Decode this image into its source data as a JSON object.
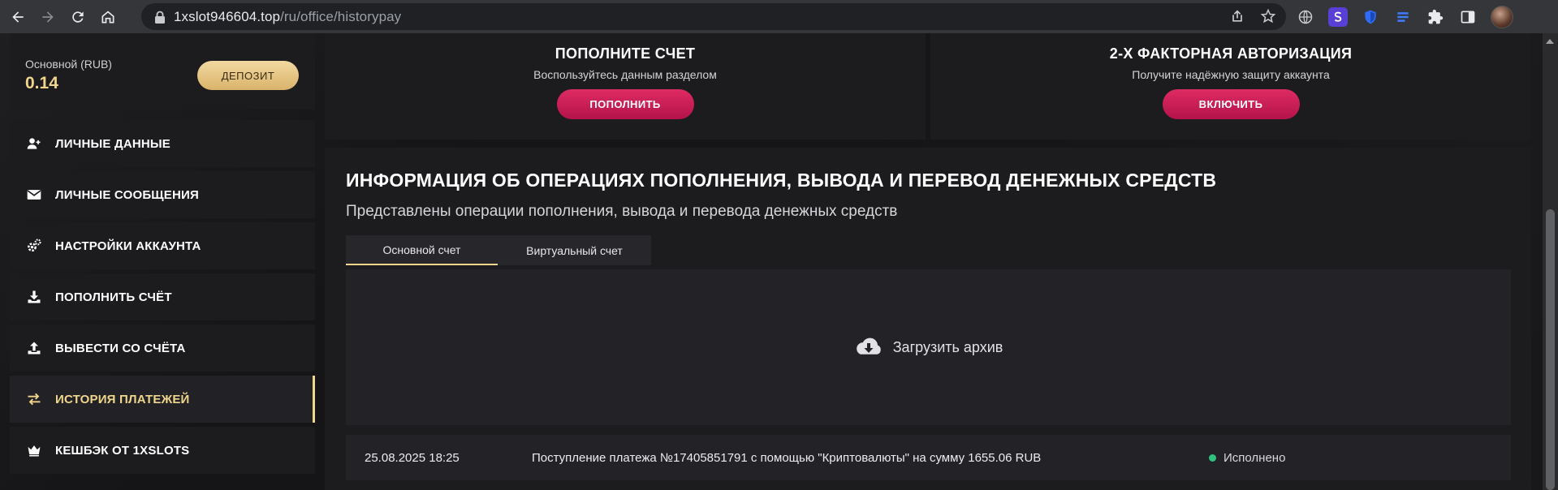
{
  "browser": {
    "url_domain": "1xslot946604.top",
    "url_path": "/ru/office/historypay"
  },
  "balance": {
    "label": "Основной (RUB)",
    "value": "0.14",
    "deposit_label": "ДЕПОЗИТ"
  },
  "sidebar": {
    "items": [
      {
        "label": "ЛИЧНЫЕ ДАННЫЕ",
        "icon": "user-plus-icon"
      },
      {
        "label": "ЛИЧНЫЕ СООБЩЕНИЯ",
        "icon": "envelope-icon"
      },
      {
        "label": "НАСТРОЙКИ АККАУНТА",
        "icon": "gears-icon"
      },
      {
        "label": "ПОПОЛНИТЬ СЧЁТ",
        "icon": "download-icon"
      },
      {
        "label": "ВЫВЕСТИ СО СЧЁТА",
        "icon": "upload-icon"
      },
      {
        "label": "ИСТОРИЯ ПЛАТЕЖЕЙ",
        "icon": "exchange-icon"
      },
      {
        "label": "КЕШБЭК ОТ 1XSLOTS",
        "icon": "crown-icon"
      }
    ]
  },
  "promo_left": {
    "title": "ПОПОЛНИТЕ СЧЕТ",
    "subtitle": "Воспользуйтесь данным разделом",
    "button": "ПОПОЛНИТЬ"
  },
  "promo_right": {
    "title": "2-Х ФАКТОРНАЯ АВТОРИЗАЦИЯ",
    "subtitle": "Получите надёжную защиту аккаунта",
    "button": "ВКЛЮЧИТЬ"
  },
  "operations": {
    "title": "ИНФОРМАЦИЯ ОБ ОПЕРАЦИЯХ ПОПОЛНЕНИЯ, ВЫВОДА И ПЕРЕВОД ДЕНЕЖНЫХ СРЕДСТВ",
    "subtitle": "Представлены операции пополнения, вывода и перевода денежных средств",
    "tabs": [
      {
        "label": "Основной счет"
      },
      {
        "label": "Виртуальный счет"
      }
    ],
    "archive_label": "Загрузить архив",
    "rows": [
      {
        "date": "25.08.2025 18:25",
        "description": "Поступление платежа №17405851791 с помощью \"Криптовалюты\" на сумму 1655.06 RUB",
        "status": "Исполнено"
      }
    ]
  },
  "colors": {
    "accent_gold": "#f0d58c",
    "button_pink": "#d0215a",
    "status_green": "#2ec27e"
  }
}
